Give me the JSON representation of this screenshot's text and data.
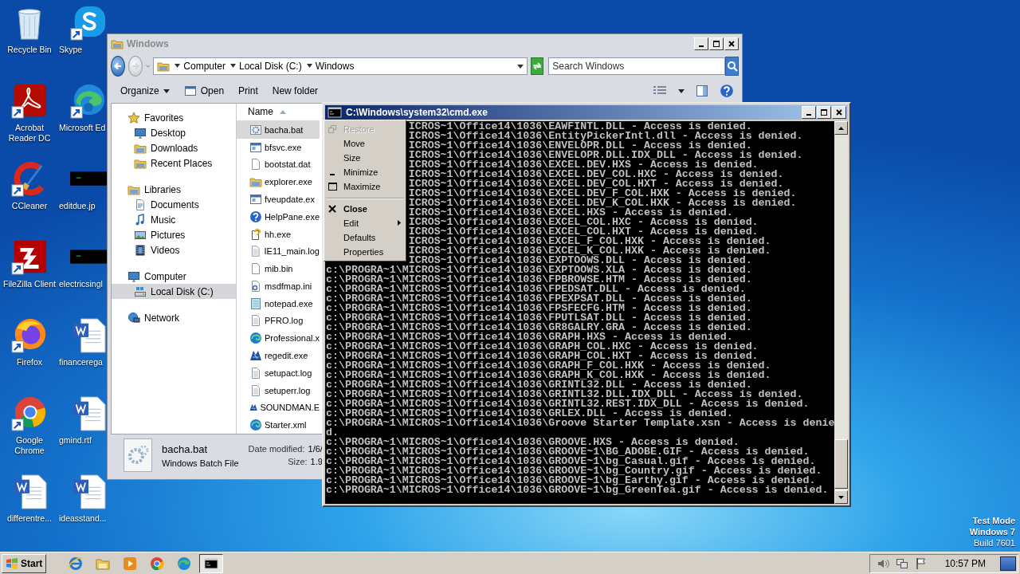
{
  "desktop_icons": [
    {
      "label": "Recycle Bin",
      "kind": "bin",
      "shortcut": false
    },
    {
      "label": "Skype",
      "kind": "skype",
      "shortcut": true
    },
    {
      "label": "Acrobat Reader DC",
      "kind": "acrobat",
      "shortcut": true
    },
    {
      "label": "Microsoft Ed",
      "kind": "edge",
      "shortcut": true
    },
    {
      "label": "CCleaner",
      "kind": "ccleaner",
      "shortcut": true
    },
    {
      "label": "editdue.jp",
      "kind": "dark-image",
      "shortcut": false
    },
    {
      "label": "FileZilla Client",
      "kind": "filezilla",
      "shortcut": true
    },
    {
      "label": "electricsingl",
      "kind": "dark-image",
      "shortcut": false
    },
    {
      "label": "Firefox",
      "kind": "firefox",
      "shortcut": true
    },
    {
      "label": "financerega",
      "kind": "word",
      "shortcut": false
    },
    {
      "label": "Google Chrome",
      "kind": "chrome",
      "shortcut": true
    },
    {
      "label": "gmind.rtf",
      "kind": "word",
      "shortcut": false
    },
    {
      "label": "differentre...",
      "kind": "word",
      "shortcut": false
    },
    {
      "label": "ideasstand...",
      "kind": "word",
      "shortcut": false
    }
  ],
  "explorer": {
    "title": "Windows",
    "breadcrumbs": [
      "Computer",
      "Local Disk (C:)",
      "Windows"
    ],
    "search": {
      "placeholder": "Search Windows"
    },
    "toolbar": [
      {
        "label": "Organize",
        "kind": "menu"
      },
      {
        "label": "Open",
        "kind": "icon"
      },
      {
        "label": "Print",
        "kind": "plain"
      },
      {
        "label": "New folder",
        "kind": "plain"
      }
    ],
    "columns": [
      {
        "label": "Name",
        "sorted": true
      }
    ],
    "navigation": [
      {
        "label": "Favorites",
        "kind": "star",
        "selected": false,
        "children": [
          {
            "label": "Desktop",
            "kind": "desktop",
            "selected": false
          },
          {
            "label": "Downloads",
            "kind": "folder",
            "selected": false
          },
          {
            "label": "Recent Places",
            "kind": "folder",
            "selected": false
          }
        ]
      },
      {
        "label": "Libraries",
        "kind": "folder",
        "selected": false,
        "children": [
          {
            "label": "Documents",
            "kind": "document",
            "selected": false
          },
          {
            "label": "Music",
            "kind": "music",
            "selected": false
          },
          {
            "label": "Pictures",
            "kind": "picture",
            "selected": false
          },
          {
            "label": "Videos",
            "kind": "film",
            "selected": false
          }
        ]
      },
      {
        "label": "Computer",
        "kind": "desktop",
        "selected": false,
        "children": [
          {
            "label": "Local Disk (C:)",
            "kind": "drive",
            "selected": true
          }
        ]
      },
      {
        "label": "Network",
        "kind": "network",
        "selected": false
      }
    ],
    "files": [
      {
        "name": "bacha.bat",
        "kind": "gear",
        "selected": true
      },
      {
        "name": "bfsvc.exe",
        "kind": "window",
        "selected": false
      },
      {
        "name": "bootstat.dat",
        "kind": "page",
        "selected": false
      },
      {
        "name": "explorer.exe",
        "kind": "folder",
        "selected": false
      },
      {
        "name": "fveupdate.ex",
        "kind": "window",
        "selected": false
      },
      {
        "name": "HelpPane.exe",
        "kind": "help",
        "selected": false
      },
      {
        "name": "hh.exe",
        "kind": "helpdoc",
        "selected": false
      },
      {
        "name": "IE11_main.log",
        "kind": "lines",
        "selected": false
      },
      {
        "name": "mib.bin",
        "kind": "page",
        "selected": false
      },
      {
        "name": "msdfmap.ini",
        "kind": "settings",
        "selected": false
      },
      {
        "name": "notepad.exe",
        "kind": "notepad",
        "selected": false
      },
      {
        "name": "PFRO.log",
        "kind": "lines",
        "selected": false
      },
      {
        "name": "Professional.x",
        "kind": "swirl",
        "selected": false
      },
      {
        "name": "regedit.exe",
        "kind": "cubes",
        "selected": false
      },
      {
        "name": "setupact.log",
        "kind": "lines",
        "selected": false
      },
      {
        "name": "setuperr.log",
        "kind": "lines",
        "selected": false
      },
      {
        "name": "SOUNDMAN.E",
        "kind": "cubes",
        "selected": false
      },
      {
        "name": "Starter.xml",
        "kind": "swirl",
        "selected": false
      }
    ],
    "details": {
      "name": "bacha.bat",
      "type": "Windows Batch File",
      "modified_label": "Date modified:",
      "modified": "1/6/",
      "size_label": "Size:",
      "size": "1.9"
    }
  },
  "console": {
    "title": "C:\\Windows\\system32\\cmd.exe",
    "lines": [
      {
        "text": "ICROS~1\\Office14\\1036\\EAWFINTL.DLL - Access is denied.",
        "covered": true
      },
      {
        "text": "ICROS~1\\Office14\\1036\\EntityPickerIntl.dll - Access is denied.",
        "covered": true
      },
      {
        "text": "ICROS~1\\Office14\\1036\\ENVELOPR.DLL - Access is denied.",
        "covered": true
      },
      {
        "text": "ICROS~1\\Office14\\1036\\ENVELOPR.DLL.IDX_DLL - Access is denied.",
        "covered": true
      },
      {
        "text": "ICROS~1\\Office14\\1036\\EXCEL.DEV.HXS - Access is denied.",
        "covered": true
      },
      {
        "text": "ICROS~1\\Office14\\1036\\EXCEL.DEV_COL.HXC - Access is denied.",
        "covered": true
      },
      {
        "text": "ICROS~1\\Office14\\1036\\EXCEL.DEV_COL.HXT - Access is denied.",
        "covered": true
      },
      {
        "text": "ICROS~1\\Office14\\1036\\EXCEL.DEV_F_COL.HXK - Access is denied.",
        "covered": true
      },
      {
        "text": "ICROS~1\\Office14\\1036\\EXCEL.DEV_K_COL.HXK - Access is denied.",
        "covered": true
      },
      {
        "text": "ICROS~1\\Office14\\1036\\EXCEL.HXS - Access is denied.",
        "covered": true
      },
      {
        "text": "ICROS~1\\Office14\\1036\\EXCEL_COL.HXC - Access is denied.",
        "covered": true
      },
      {
        "text": "ICROS~1\\Office14\\1036\\EXCEL_COL.HXT - Access is denied.",
        "covered": true
      },
      {
        "text": "ICROS~1\\Office14\\1036\\EXCEL_F_COL.HXK - Access is denied.",
        "covered": true
      },
      {
        "text": "ICROS~1\\Office14\\1036\\EXCEL_K_COL.HXK - Access is denied.",
        "covered": true
      },
      {
        "text": "ICROS~1\\Office14\\1036\\EXPTOOWS.DLL - Access is denied.",
        "covered": true
      },
      {
        "text": "c:\\PROGRA~1\\MICROS~1\\Office14\\1036\\EXPTOOWS.XLA - Access is denied.",
        "covered": false
      },
      {
        "text": "c:\\PROGRA~1\\MICROS~1\\Office14\\1036\\FPBROWSE.HTM - Access is denied.",
        "covered": false
      },
      {
        "text": "c:\\PROGRA~1\\MICROS~1\\Office14\\1036\\FPEDSAT.DLL - Access is denied.",
        "covered": false
      },
      {
        "text": "c:\\PROGRA~1\\MICROS~1\\Office14\\1036\\FPEXPSAT.DLL - Access is denied.",
        "covered": false
      },
      {
        "text": "c:\\PROGRA~1\\MICROS~1\\Office14\\1036\\FPSFECFG.HTM - Access is denied.",
        "covered": false
      },
      {
        "text": "c:\\PROGRA~1\\MICROS~1\\Office14\\1036\\FPUTLSAT.DLL - Access is denied.",
        "covered": false
      },
      {
        "text": "c:\\PROGRA~1\\MICROS~1\\Office14\\1036\\GR8GALRY.GRA - Access is denied.",
        "covered": false
      },
      {
        "text": "c:\\PROGRA~1\\MICROS~1\\Office14\\1036\\GRAPH.HXS - Access is denied.",
        "covered": false
      },
      {
        "text": "c:\\PROGRA~1\\MICROS~1\\Office14\\1036\\GRAPH_COL.HXC - Access is denied.",
        "covered": false
      },
      {
        "text": "c:\\PROGRA~1\\MICROS~1\\Office14\\1036\\GRAPH_COL.HXT - Access is denied.",
        "covered": false
      },
      {
        "text": "c:\\PROGRA~1\\MICROS~1\\Office14\\1036\\GRAPH_F_COL.HXK - Access is denied.",
        "covered": false
      },
      {
        "text": "c:\\PROGRA~1\\MICROS~1\\Office14\\1036\\GRAPH_K_COL.HXK - Access is denied.",
        "covered": false
      },
      {
        "text": "c:\\PROGRA~1\\MICROS~1\\Office14\\1036\\GRINTL32.DLL - Access is denied.",
        "covered": false
      },
      {
        "text": "c:\\PROGRA~1\\MICROS~1\\Office14\\1036\\GRINTL32.DLL.IDX_DLL - Access is denied.",
        "covered": false
      },
      {
        "text": "c:\\PROGRA~1\\MICROS~1\\Office14\\1036\\GRINTL32.REST.IDX_DLL - Access is denied.",
        "covered": false
      },
      {
        "text": "c:\\PROGRA~1\\MICROS~1\\Office14\\1036\\GRLEX.DLL - Access is denied.",
        "covered": false
      },
      {
        "text": "c:\\PROGRA~1\\MICROS~1\\Office14\\1036\\Groove Starter Template.xsn - Access is denie",
        "covered": false
      },
      {
        "text": "d.",
        "covered": false
      },
      {
        "text": "c:\\PROGRA~1\\MICROS~1\\Office14\\1036\\GROOVE.HXS - Access is denied.",
        "covered": false
      },
      {
        "text": "c:\\PROGRA~1\\MICROS~1\\Office14\\1036\\GROOVE~1\\BG_ADOBE.GIF - Access is denied.",
        "covered": false
      },
      {
        "text": "c:\\PROGRA~1\\MICROS~1\\Office14\\1036\\GROOVE~1\\bg_Casual.gif - Access is denied.",
        "covered": false
      },
      {
        "text": "c:\\PROGRA~1\\MICROS~1\\Office14\\1036\\GROOVE~1\\bg_Country.gif - Access is denied.",
        "covered": false
      },
      {
        "text": "c:\\PROGRA~1\\MICROS~1\\Office14\\1036\\GROOVE~1\\bg_Earthy.gif - Access is denied.",
        "covered": false
      },
      {
        "text": "c:\\PROGRA~1\\MICROS~1\\Office14\\1036\\GROOVE~1\\bg_GreenTea.gif - Access is denied.",
        "covered": false
      }
    ]
  },
  "system_menu": {
    "items": [
      {
        "label": "Restore",
        "kind": "restore",
        "disabled": true,
        "default": false,
        "submenu": false,
        "separator_before": false
      },
      {
        "label": "Move",
        "kind": "none",
        "disabled": false,
        "default": false,
        "submenu": false,
        "separator_before": false
      },
      {
        "label": "Size",
        "kind": "none",
        "disabled": false,
        "default": false,
        "submenu": false,
        "separator_before": false
      },
      {
        "label": "Minimize",
        "kind": "minimize",
        "disabled": false,
        "default": false,
        "submenu": false,
        "separator_before": false
      },
      {
        "label": "Maximize",
        "kind": "maximize",
        "disabled": false,
        "default": false,
        "submenu": false,
        "separator_before": false
      },
      {
        "label": "Close",
        "kind": "close",
        "disabled": false,
        "default": true,
        "submenu": false,
        "separator_before": true
      },
      {
        "label": "Edit",
        "kind": "none",
        "disabled": false,
        "default": false,
        "submenu": true,
        "separator_before": false
      },
      {
        "label": "Defaults",
        "kind": "none",
        "disabled": false,
        "default": false,
        "submenu": false,
        "separator_before": false
      },
      {
        "label": "Properties",
        "kind": "none",
        "disabled": false,
        "default": false,
        "submenu": false,
        "separator_before": false
      }
    ]
  },
  "desktop_notice": [
    "Test Mode",
    "Windows 7",
    "Build 7601"
  ],
  "taskbar": {
    "start": "Start",
    "apps": [
      {
        "kind": "ie",
        "active": false
      },
      {
        "kind": "explorer",
        "active": false
      },
      {
        "kind": "media",
        "active": false
      },
      {
        "kind": "chrome",
        "active": false
      },
      {
        "kind": "edge",
        "active": false
      },
      {
        "kind": "cmd",
        "active": true
      }
    ],
    "clock": "10:57 PM"
  }
}
